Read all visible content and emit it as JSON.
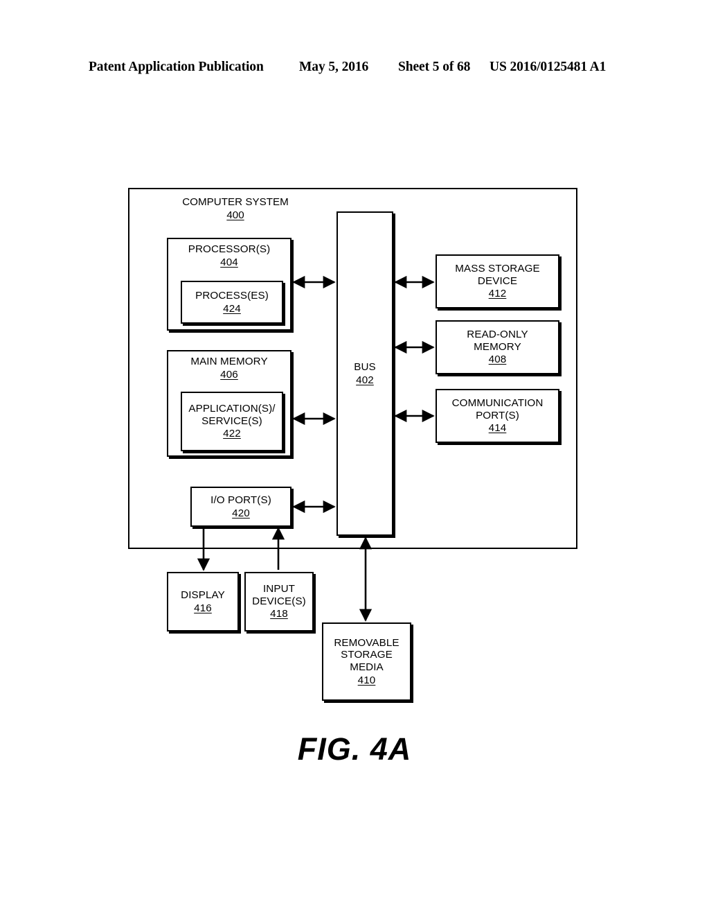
{
  "header": {
    "publication": "Patent Application Publication",
    "date": "May 5, 2016",
    "sheet": "Sheet 5 of 68",
    "publication_number": "US 2016/0125481 A1"
  },
  "figure": {
    "caption": "FIG. 4A",
    "line_color": "#000000",
    "background_color": "#ffffff"
  },
  "diagram": {
    "container": {
      "title": "COMPUTER SYSTEM",
      "ref": "400"
    },
    "bus": {
      "title": "BUS",
      "ref": "402"
    },
    "blocks": {
      "processor": {
        "line1": "PROCESSOR(S)",
        "ref": "404"
      },
      "process": {
        "line1": "PROCESS(ES)",
        "ref": "424"
      },
      "main_memory": {
        "line1": "MAIN MEMORY",
        "ref": "406"
      },
      "application_service": {
        "line1": "APPLICATION(S)/",
        "line2": "SERVICE(S)",
        "ref": "422"
      },
      "io_ports": {
        "line1": "I/O PORT(S)",
        "ref": "420"
      },
      "mass_storage": {
        "line1": "MASS STORAGE",
        "line2": "DEVICE",
        "ref": "412"
      },
      "read_only_memory": {
        "line1": "READ-ONLY",
        "line2": "MEMORY",
        "ref": "408"
      },
      "communication_ports": {
        "line1": "COMMUNICATION",
        "line2": "PORT(S)",
        "ref": "414"
      },
      "display": {
        "line1": "DISPLAY",
        "ref": "416"
      },
      "input_devices": {
        "line1": "INPUT",
        "line2": "DEVICE(S)",
        "ref": "418"
      },
      "removable_storage": {
        "line1": "REMOVABLE",
        "line2": "STORAGE",
        "line3": "MEDIA",
        "ref": "410"
      }
    },
    "connections": [
      {
        "from": "processor",
        "to": "bus",
        "type": "bidirectional"
      },
      {
        "from": "main_memory",
        "to": "bus",
        "type": "bidirectional"
      },
      {
        "from": "io_ports",
        "to": "bus",
        "type": "bidirectional"
      },
      {
        "from": "bus",
        "to": "mass_storage",
        "type": "bidirectional"
      },
      {
        "from": "bus",
        "to": "read_only_memory",
        "type": "bidirectional"
      },
      {
        "from": "bus",
        "to": "communication_ports",
        "type": "bidirectional"
      },
      {
        "from": "io_ports",
        "to": "display",
        "type": "unidirectional"
      },
      {
        "from": "input_devices",
        "to": "io_ports",
        "type": "unidirectional"
      },
      {
        "from": "bus",
        "to": "removable_storage",
        "type": "bidirectional"
      }
    ]
  }
}
